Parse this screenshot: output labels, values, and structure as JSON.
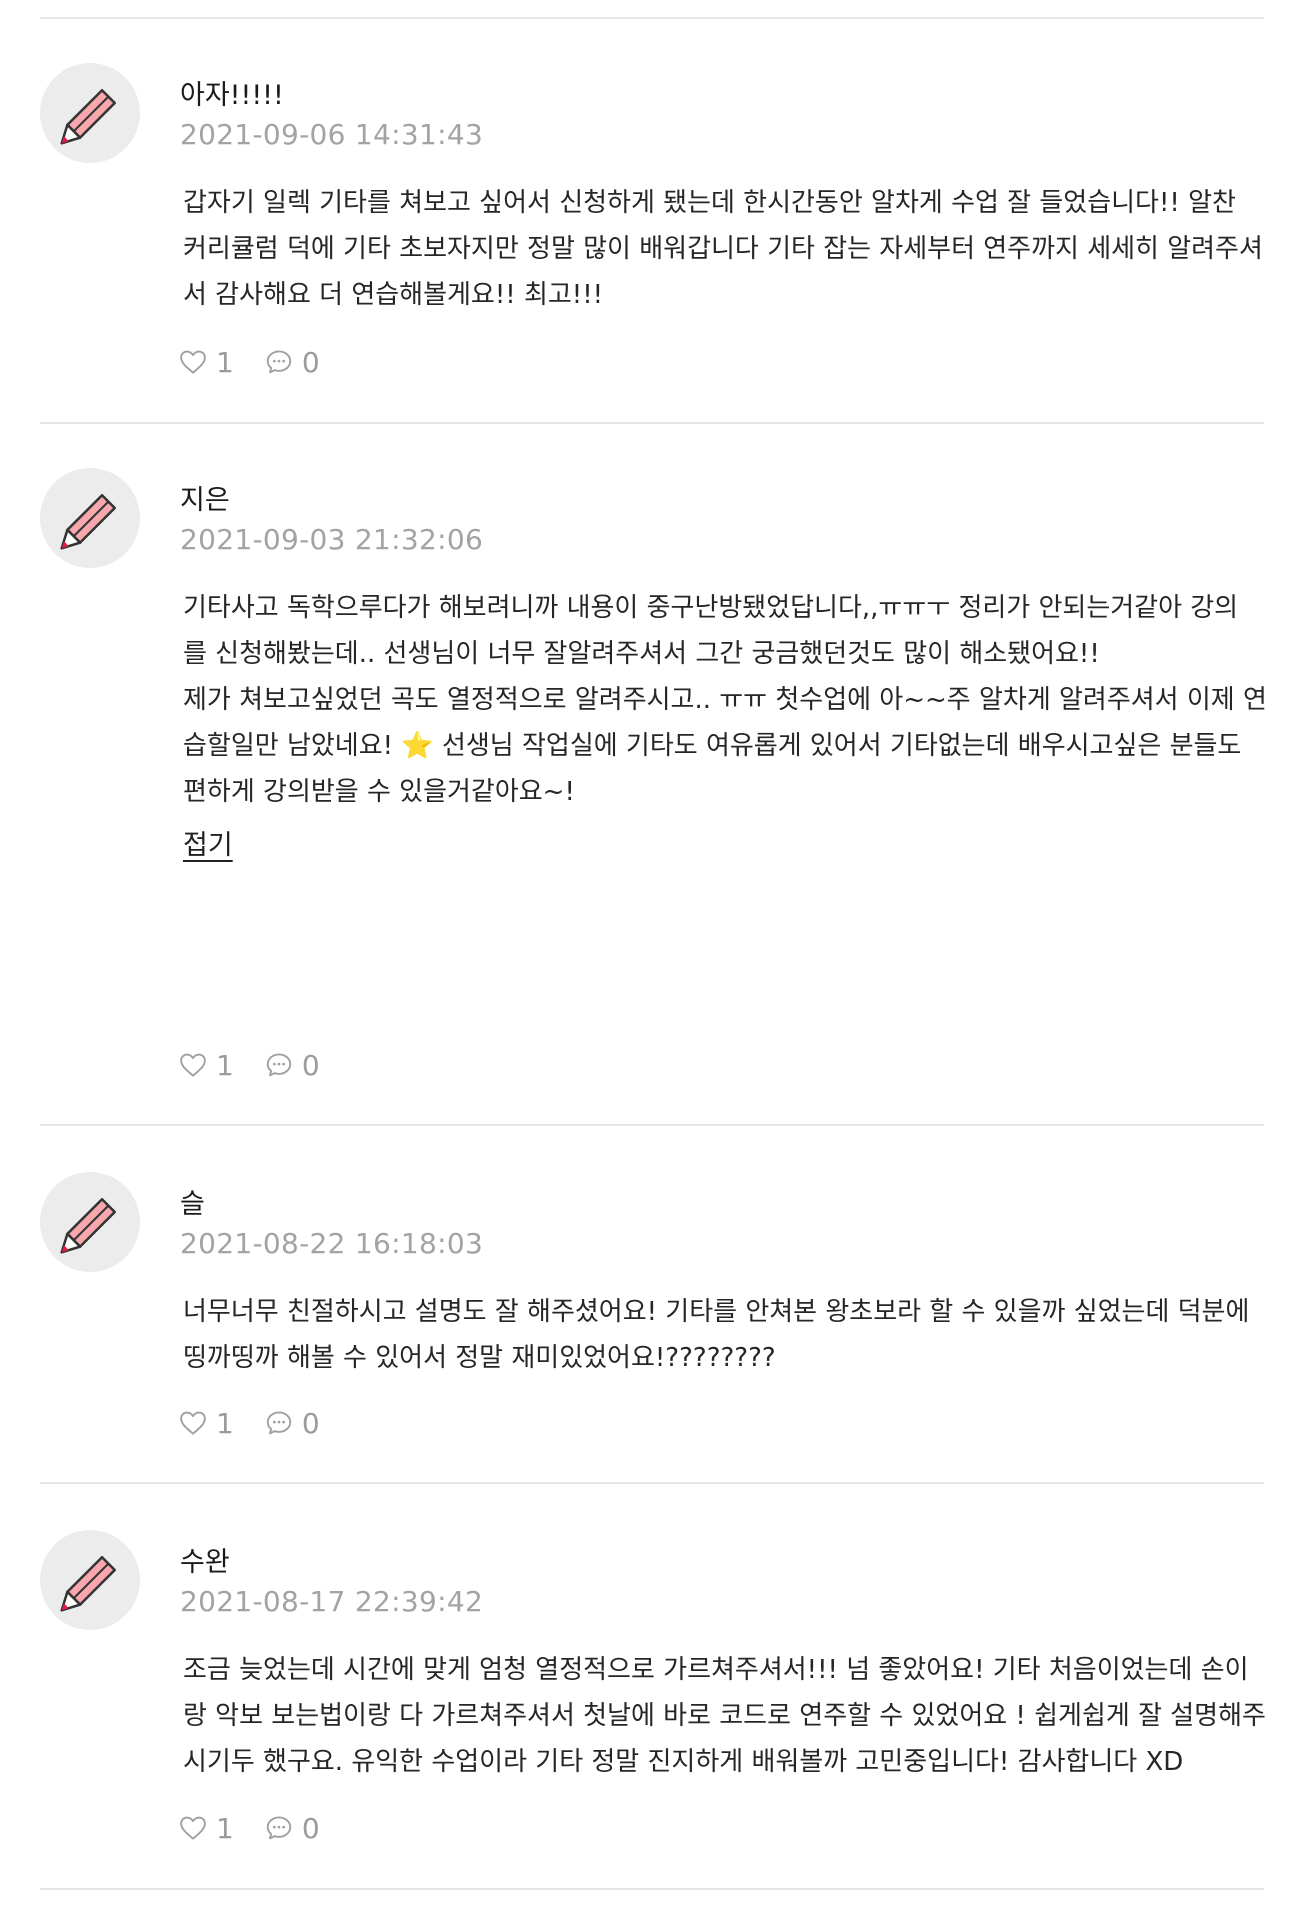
{
  "reviews": [
    {
      "author": "아자!!!!!",
      "date": "2021-09-06 14:31:43",
      "lines": [
        "갑자기 일렉 기타를 쳐보고 싶어서 신청하게 됐는데 한시간동안 알차게 수업 잘 들었습니다!! 알찬",
        "커리큘럼 덕에 기타 초보자지만 정말 많이 배워갑니다 기타 잡는 자세부터 연주까지 세세히 알려주셔",
        "서 감사해요 더 연습해볼게요!! 최고!!!"
      ],
      "likes": "1",
      "comments": "0"
    },
    {
      "author": "지은",
      "date": "2021-09-03 21:32:06",
      "lines": [
        "기타사고 독학으루다가 해보려니까 내용이 중구난방됐었답니다,,ㅠㅠㅜ 정리가 안되는거같아 강의",
        "를 신청해봤는데.. 선생님이 너무 잘알려주셔서 그간 궁금했던것도 많이 해소됐어요!!",
        "제가 쳐보고싶었던 곡도 열정적으로 알려주시고.. ㅠㅠ 첫수업에 아~~주 알차게 알려주셔서 이제 연",
        "습할일만 남았네요! ⭐ 선생님 작업실에 기타도 여유롭게 있어서 기타없는데 배우시고싶은 분들도",
        "편하게 강의받을 수 있을거같아요~!"
      ],
      "fold_label": "접기",
      "likes": "1",
      "comments": "0"
    },
    {
      "author": "슬",
      "date": "2021-08-22 16:18:03",
      "lines": [
        "너무너무 친절하시고 설명도 잘 해주셨어요! 기타를 안쳐본 왕초보라 할 수 있을까 싶었는데 덕분에",
        "띵까띵까 해볼 수 있어서 정말 재미있었어요!????????"
      ],
      "likes": "1",
      "comments": "0"
    },
    {
      "author": "수완",
      "date": "2021-08-17 22:39:42",
      "lines": [
        "조금 늦었는데 시간에 맞게 엄청 열정적으로 가르쳐주셔서!!! 넘 좋았어요! 기타 처음이었는데 손이",
        "랑 악보 보는법이랑 다 가르쳐주셔서 첫날에 바로 코드로 연주할 수 있었어요 ! 쉽게쉽게 잘 설명해주",
        "시기두 했구요. 유익한 수업이라 기타 정말 진지하게 배워볼까 고민중입니다! 감사합니다 XD"
      ],
      "likes": "1",
      "comments": "0"
    }
  ],
  "icons": {
    "avatar": "pencil-avatar-icon",
    "like": "heart-outline-icon",
    "comment": "speech-bubble-icon"
  },
  "colors": {
    "avatar_bg": "#ececec",
    "pencil_body": "#f7a7ad",
    "pencil_tip": "#e5184a",
    "meta_gray": "#a3a3a3",
    "divider": "#e6e6e6"
  }
}
